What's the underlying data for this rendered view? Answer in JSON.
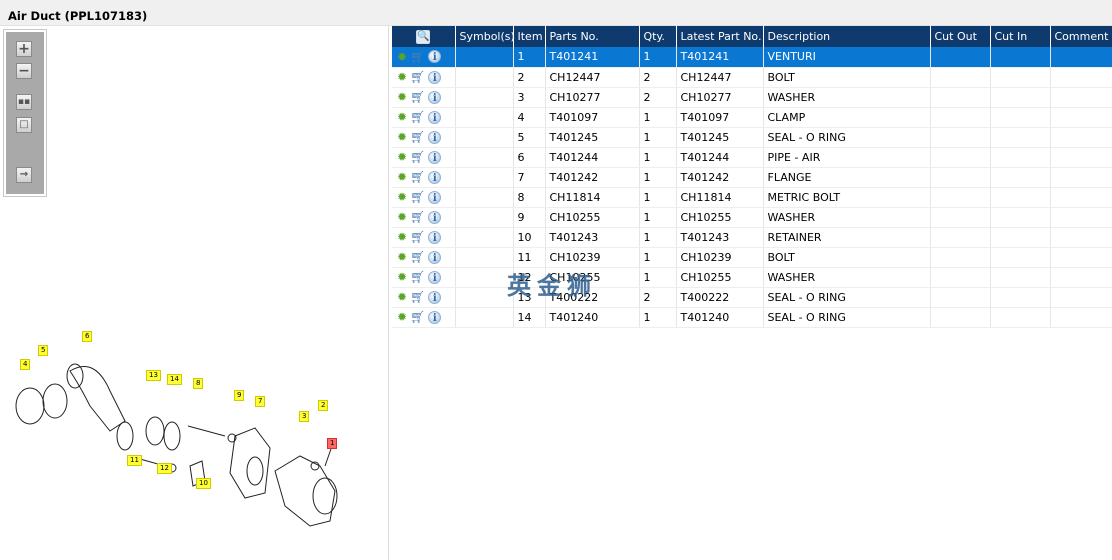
{
  "title": "Air Duct (PPL107183)",
  "toolbar": {
    "icons": [
      "zoom-in-icon",
      "zoom-out-icon",
      "fit-icon",
      "actual-size-icon",
      "export-icon"
    ]
  },
  "table": {
    "headers": [
      "",
      "Symbol(s)",
      "Item",
      "Parts No.",
      "Qty.",
      "Latest Part No.",
      "Description",
      "Cut Out",
      "Cut In",
      "Comment"
    ],
    "rows": [
      {
        "item": "1",
        "part": "T401241",
        "qty": "1",
        "latest": "T401241",
        "desc": "VENTURI",
        "selected": true
      },
      {
        "item": "2",
        "part": "CH12447",
        "qty": "2",
        "latest": "CH12447",
        "desc": "BOLT"
      },
      {
        "item": "3",
        "part": "CH10277",
        "qty": "2",
        "latest": "CH10277",
        "desc": "WASHER"
      },
      {
        "item": "4",
        "part": "T401097",
        "qty": "1",
        "latest": "T401097",
        "desc": "CLAMP"
      },
      {
        "item": "5",
        "part": "T401245",
        "qty": "1",
        "latest": "T401245",
        "desc": "SEAL - O RING"
      },
      {
        "item": "6",
        "part": "T401244",
        "qty": "1",
        "latest": "T401244",
        "desc": "PIPE - AIR"
      },
      {
        "item": "7",
        "part": "T401242",
        "qty": "1",
        "latest": "T401242",
        "desc": "FLANGE"
      },
      {
        "item": "8",
        "part": "CH11814",
        "qty": "1",
        "latest": "CH11814",
        "desc": "METRIC BOLT"
      },
      {
        "item": "9",
        "part": "CH10255",
        "qty": "1",
        "latest": "CH10255",
        "desc": "WASHER"
      },
      {
        "item": "10",
        "part": "T401243",
        "qty": "1",
        "latest": "T401243",
        "desc": "RETAINER"
      },
      {
        "item": "11",
        "part": "CH10239",
        "qty": "1",
        "latest": "CH10239",
        "desc": "BOLT"
      },
      {
        "item": "12",
        "part": "CH10255",
        "qty": "1",
        "latest": "CH10255",
        "desc": "WASHER"
      },
      {
        "item": "13",
        "part": "T400222",
        "qty": "2",
        "latest": "T400222",
        "desc": "SEAL - O RING"
      },
      {
        "item": "14",
        "part": "T401240",
        "qty": "1",
        "latest": "T401240",
        "desc": "SEAL - O RING"
      }
    ]
  },
  "watermark": "英金狮",
  "diagram": {
    "callouts": [
      "1",
      "2",
      "3",
      "4",
      "5",
      "6",
      "7",
      "8",
      "9",
      "10",
      "11",
      "12",
      "13",
      "14"
    ]
  }
}
